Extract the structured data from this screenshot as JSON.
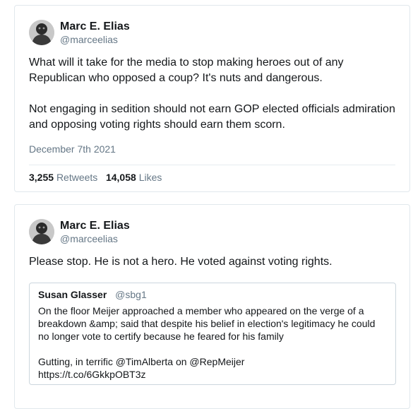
{
  "tweets": [
    {
      "author": {
        "name": "Marc E. Elias",
        "handle": "@marceelias"
      },
      "paragraphs": [
        "What will it take for the media to stop making heroes out of any Republican who opposed a coup? It's nuts and dangerous.",
        "Not engaging in sedition should not earn GOP elected officials admiration and opposing voting rights should earn them scorn."
      ],
      "date": "December 7th 2021",
      "retweets_count": "3,255",
      "retweets_label": "Retweets",
      "likes_count": "14,058",
      "likes_label": "Likes"
    },
    {
      "author": {
        "name": "Marc E. Elias",
        "handle": "@marceelias"
      },
      "text": "Please stop. He is not a hero. He voted against voting rights.",
      "quote": {
        "name": "Susan Glasser",
        "handle": "@sbg1",
        "line1": "On the floor Meijer approached a member who appeared on the verge of a breakdown &amp; said that despite his belief in election's legitimacy he could no longer vote to certify because he feared for his family",
        "line2": "Gutting, in terrific @TimAlberta on @RepMeijer",
        "line3": "https://t.co/6GkkpOBT3z"
      }
    }
  ]
}
